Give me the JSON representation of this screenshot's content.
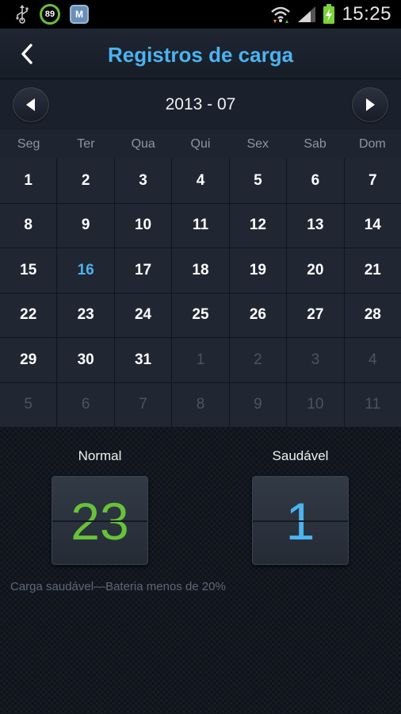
{
  "status_bar": {
    "notification_badge": "89",
    "app_icon_letter": "M",
    "time": "15:25"
  },
  "header": {
    "title": "Registros de carga"
  },
  "month_nav": {
    "label": "2013 - 07"
  },
  "calendar": {
    "weekdays": [
      "Seg",
      "Ter",
      "Qua",
      "Qui",
      "Sex",
      "Sab",
      "Dom"
    ],
    "days": [
      {
        "n": "1",
        "cur": true
      },
      {
        "n": "2",
        "cur": true
      },
      {
        "n": "3",
        "cur": true
      },
      {
        "n": "4",
        "cur": true
      },
      {
        "n": "5",
        "cur": true
      },
      {
        "n": "6",
        "cur": true
      },
      {
        "n": "7",
        "cur": true
      },
      {
        "n": "8",
        "cur": true
      },
      {
        "n": "9",
        "cur": true
      },
      {
        "n": "10",
        "cur": true
      },
      {
        "n": "11",
        "cur": true
      },
      {
        "n": "12",
        "cur": true
      },
      {
        "n": "13",
        "cur": true
      },
      {
        "n": "14",
        "cur": true
      },
      {
        "n": "15",
        "cur": true
      },
      {
        "n": "16",
        "cur": true,
        "today": true
      },
      {
        "n": "17",
        "cur": true
      },
      {
        "n": "18",
        "cur": true
      },
      {
        "n": "19",
        "cur": true
      },
      {
        "n": "20",
        "cur": true
      },
      {
        "n": "21",
        "cur": true
      },
      {
        "n": "22",
        "cur": true
      },
      {
        "n": "23",
        "cur": true
      },
      {
        "n": "24",
        "cur": true
      },
      {
        "n": "25",
        "cur": true
      },
      {
        "n": "26",
        "cur": true
      },
      {
        "n": "27",
        "cur": true
      },
      {
        "n": "28",
        "cur": true
      },
      {
        "n": "29",
        "cur": true
      },
      {
        "n": "30",
        "cur": true
      },
      {
        "n": "31",
        "cur": true
      },
      {
        "n": "1",
        "cur": false
      },
      {
        "n": "2",
        "cur": false
      },
      {
        "n": "3",
        "cur": false
      },
      {
        "n": "4",
        "cur": false
      },
      {
        "n": "5",
        "cur": false
      },
      {
        "n": "6",
        "cur": false
      },
      {
        "n": "7",
        "cur": false
      },
      {
        "n": "8",
        "cur": false
      },
      {
        "n": "9",
        "cur": false
      },
      {
        "n": "10",
        "cur": false
      },
      {
        "n": "11",
        "cur": false
      }
    ]
  },
  "stats": {
    "normal_label": "Normal",
    "normal_value": "23",
    "healthy_label": "Saudável",
    "healthy_value": "1",
    "note": "Carga saudável—Bateria menos de 20%"
  },
  "colors": {
    "accent": "#4cb3f0",
    "normal_green": "#67c23a"
  }
}
